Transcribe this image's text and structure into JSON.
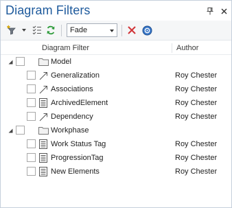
{
  "window": {
    "title": "Diagram Filters"
  },
  "toolbar": {
    "mode_value": "Fade",
    "icons": [
      "filter-icon",
      "checklist-icon",
      "refresh-icon",
      "delete-icon",
      "help-icon"
    ]
  },
  "columns": {
    "filter": "Diagram Filter",
    "author": "Author"
  },
  "colors": {
    "title": "#1e5a9c",
    "delete": "#d13438",
    "help": "#2b6cb0",
    "refresh": "#2e9b3a"
  },
  "tree": [
    {
      "type": "group",
      "name": "Model",
      "author": "",
      "expanded": true,
      "children": [
        {
          "name": "Generalization",
          "author": "Roy Chester",
          "icon": "connector-icon"
        },
        {
          "name": "Associations",
          "author": "Roy Chester",
          "icon": "connector-icon"
        },
        {
          "name": "ArchivedElement",
          "author": "Roy Chester",
          "icon": "element-filter-icon"
        },
        {
          "name": "Dependency",
          "author": "Roy Chester",
          "icon": "connector-icon"
        }
      ]
    },
    {
      "type": "group",
      "name": "Workphase",
      "author": "",
      "expanded": true,
      "children": [
        {
          "name": "Work Status Tag",
          "author": "Roy Chester",
          "icon": "element-filter-icon"
        },
        {
          "name": "ProgressionTag",
          "author": "Roy Chester",
          "icon": "element-filter-icon"
        },
        {
          "name": "New Elements",
          "author": "Roy Chester",
          "icon": "element-filter-icon"
        }
      ]
    }
  ]
}
